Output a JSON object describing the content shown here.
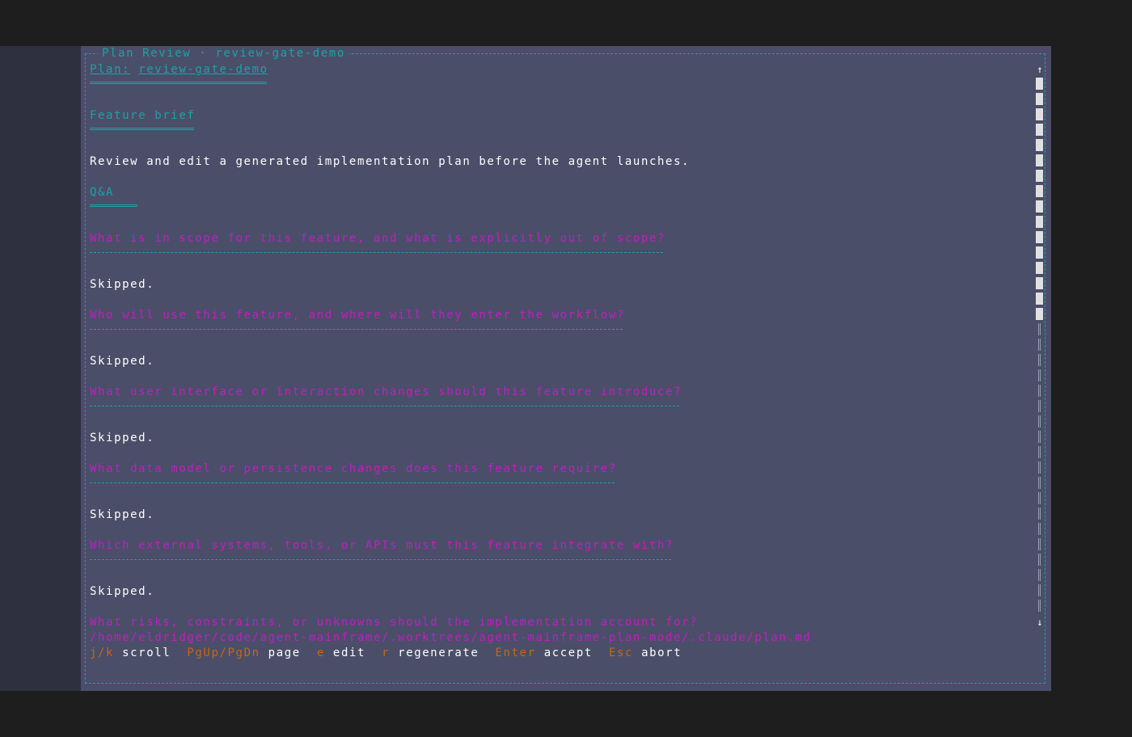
{
  "window": {
    "title": "Plan Review · review-gate-demo"
  },
  "plan": {
    "label": "Plan:",
    "name": "review-gate-demo"
  },
  "brief": {
    "heading": "Feature brief",
    "text": "Review and edit a generated implementation plan before the agent launches."
  },
  "qa": {
    "heading": "Q&A",
    "items": [
      {
        "question": "What is in scope for this feature, and what is explicitly out of scope?",
        "answer": "Skipped."
      },
      {
        "question": "Who will use this feature, and where will they enter the workflow?",
        "answer": "Skipped."
      },
      {
        "question": "What user interface or interaction changes should this feature introduce?",
        "answer": "Skipped."
      },
      {
        "question": "What data model or persistence changes does this feature require?",
        "answer": "Skipped."
      },
      {
        "question": "Which external systems, tools, or APIs must this feature integrate with?",
        "answer": "Skipped."
      },
      {
        "question": "What risks, constraints, or unknowns should the implementation account for?"
      }
    ]
  },
  "file_path": "/home/eldridger/code/agent-mainframe/.worktrees/agent-mainframe-plan-mode/.claude/plan.md",
  "keybindings": [
    {
      "key": "j/k",
      "action": "scroll"
    },
    {
      "key": "PgUp/PgDn",
      "action": "page"
    },
    {
      "key": "e",
      "action": "edit"
    },
    {
      "key": "r",
      "action": "regenerate"
    },
    {
      "key": "Enter",
      "action": "accept"
    },
    {
      "key": "Esc",
      "action": "abort"
    }
  ],
  "scrollbar": {
    "up_icon": "↑",
    "down_icon": "↓",
    "position_fraction": 0
  },
  "colors": {
    "accent_cyan": "#1aa3a8",
    "question_magenta": "#c01ec4",
    "key_orange": "#c7680e",
    "terminal_bg": "#4a4e68"
  }
}
